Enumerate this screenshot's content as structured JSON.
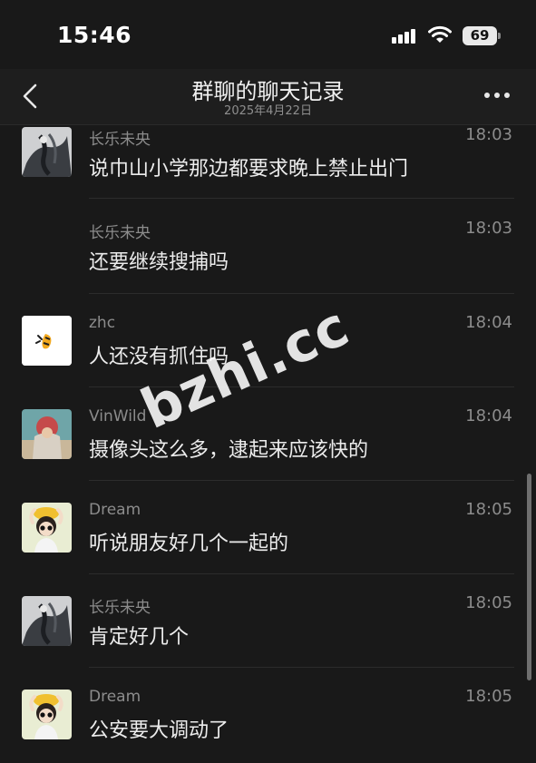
{
  "status_bar": {
    "time": "15:46",
    "battery": "69"
  },
  "nav": {
    "title": "群聊的聊天记录",
    "subtitle": "2025年4月22日"
  },
  "messages": [
    {
      "sender": "长乐未央",
      "time": "18:03",
      "text": "说巾山小学那边都要求晚上禁止出门",
      "avatar": "ink-painting-avatar"
    },
    {
      "sender": "长乐未央",
      "time": "18:03",
      "text": "还要继续搜捕吗",
      "avatar": ""
    },
    {
      "sender": "zhc",
      "time": "18:04",
      "text": "人还没有抓住吗",
      "avatar": "bee-logo-avatar"
    },
    {
      "sender": "VinWild",
      "time": "18:04",
      "text": "摄像头这么多，逮起来应该快的",
      "avatar": "poster-avatar"
    },
    {
      "sender": "Dream",
      "time": "18:05",
      "text": "听说朋友好几个一起的",
      "avatar": "girl-avatar"
    },
    {
      "sender": "长乐未央",
      "time": "18:05",
      "text": "肯定好几个",
      "avatar": "ink-painting-avatar"
    },
    {
      "sender": "Dream",
      "time": "18:05",
      "text": "公安要大调动了",
      "avatar": "girl-avatar"
    }
  ],
  "watermark": "bzhi.cc",
  "colors": {
    "background": "#191919",
    "nav_background": "#1e1e1e",
    "sender_text": "#8c8c8c",
    "message_text": "#ececec"
  }
}
